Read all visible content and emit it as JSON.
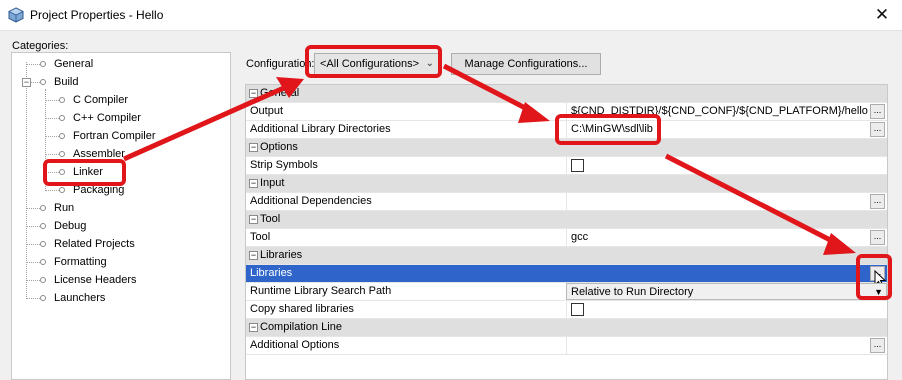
{
  "window": {
    "title": "Project Properties - Hello",
    "close_glyph": "✕"
  },
  "categories": {
    "label": "Categories:",
    "items": [
      {
        "label": "General"
      },
      {
        "label": "Build",
        "toggle": "−"
      },
      {
        "label": "C Compiler"
      },
      {
        "label": "C++ Compiler"
      },
      {
        "label": "Fortran Compiler"
      },
      {
        "label": "Assembler"
      },
      {
        "label": "Linker"
      },
      {
        "label": "Packaging"
      },
      {
        "label": "Run"
      },
      {
        "label": "Debug"
      },
      {
        "label": "Related Projects"
      },
      {
        "label": "Formatting"
      },
      {
        "label": "License Headers"
      },
      {
        "label": "Launchers"
      }
    ]
  },
  "configuration": {
    "label": "Configuration:",
    "selected": "<All Configurations>",
    "manage_label": "Manage Configurations..."
  },
  "properties": {
    "toggle_glyph": "−",
    "ellipsis": "...",
    "dropdown_glyph": "▼",
    "sections": [
      {
        "title": "General",
        "rows": [
          {
            "name": "Output",
            "value": "${CND_DISTDIR}/${CND_CONF}/${CND_PLATFORM}/hello"
          },
          {
            "name": "Additional Library Directories",
            "value": "C:\\MinGW\\sdl\\lib"
          }
        ]
      },
      {
        "title": "Options",
        "rows": [
          {
            "name": "Strip Symbols",
            "checked": false
          }
        ]
      },
      {
        "title": "Input",
        "rows": [
          {
            "name": "Additional Dependencies",
            "value": ""
          }
        ]
      },
      {
        "title": "Tool",
        "rows": [
          {
            "name": "Tool",
            "value": "gcc"
          }
        ]
      },
      {
        "title": "Libraries",
        "rows": [
          {
            "name": "Libraries",
            "value": "",
            "selected": true
          },
          {
            "name": "Runtime Library Search Path",
            "value": "Relative to Run Directory"
          },
          {
            "name": "Copy shared libraries",
            "checked": false
          }
        ]
      },
      {
        "title": "Compilation Line",
        "rows": [
          {
            "name": "Additional Options",
            "value": ""
          }
        ]
      }
    ]
  },
  "colors": {
    "annotation": "#e0161a",
    "selection": "#2f65ca"
  }
}
